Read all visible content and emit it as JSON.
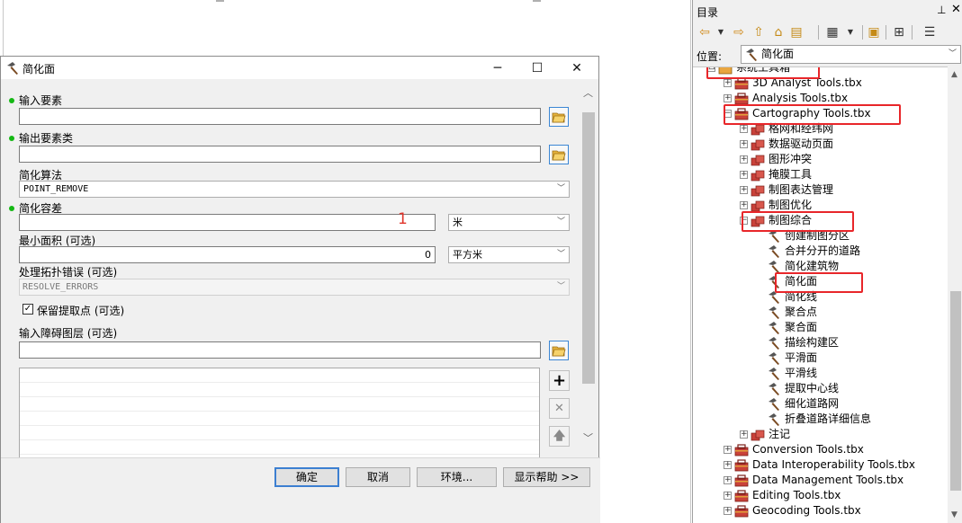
{
  "dialog": {
    "title": "简化面",
    "controls": {
      "minimize": "─",
      "maximize": "☐",
      "close": "✕"
    },
    "fields": {
      "input_features": {
        "label": "输入要素",
        "value": ""
      },
      "output_features": {
        "label": "输出要素类",
        "value": ""
      },
      "algorithm": {
        "label": "简化算法",
        "value": "POINT_REMOVE"
      },
      "tolerance": {
        "label": "简化容差",
        "value": "",
        "unit": "米",
        "annotation": "1"
      },
      "min_area": {
        "label": "最小面积 (可选)",
        "value": "0",
        "unit": "平方米"
      },
      "topology_errors": {
        "label": "处理拓扑错误 (可选)",
        "value": "RESOLVE_ERRORS"
      },
      "keep_points": {
        "label": "保留提取点 (可选)",
        "checked": true,
        "check_mark": "✓"
      },
      "barrier_layers": {
        "label": "输入障碍图层 (可选)",
        "value": ""
      }
    },
    "side_buttons": {
      "add": "+",
      "remove": "✕",
      "up": "🡅"
    },
    "buttons": {
      "ok": "确定",
      "cancel": "取消",
      "env": "环境...",
      "help": "显示帮助 >>"
    }
  },
  "catalog": {
    "title": "目录",
    "pin": "⊥",
    "close": "✕",
    "location_label": "位置:",
    "location_value": "简化面",
    "tree": [
      {
        "label": "系统工具箱",
        "expander": "⊟",
        "type": "toolbox-folder"
      },
      {
        "label": "3D Analyst Tools.tbx",
        "expander": "+",
        "type": "toolbox"
      },
      {
        "label": "Analysis Tools.tbx",
        "expander": "+",
        "type": "toolbox"
      },
      {
        "label": "Cartography Tools.tbx",
        "expander": "−",
        "type": "toolbox"
      },
      {
        "label": "格网和经纬网",
        "expander": "+",
        "type": "toolset"
      },
      {
        "label": "数据驱动页面",
        "expander": "+",
        "type": "toolset"
      },
      {
        "label": "图形冲突",
        "expander": "+",
        "type": "toolset"
      },
      {
        "label": "掩膜工具",
        "expander": "+",
        "type": "toolset"
      },
      {
        "label": "制图表达管理",
        "expander": "+",
        "type": "toolset"
      },
      {
        "label": "制图优化",
        "expander": "+",
        "type": "toolset"
      },
      {
        "label": "制图综合",
        "expander": "−",
        "type": "toolset"
      },
      {
        "label": "创建制图分区",
        "type": "tool"
      },
      {
        "label": "合并分开的道路",
        "type": "tool"
      },
      {
        "label": "简化建筑物",
        "type": "tool"
      },
      {
        "label": "简化面",
        "type": "tool"
      },
      {
        "label": "简化线",
        "type": "tool"
      },
      {
        "label": "聚合点",
        "type": "tool"
      },
      {
        "label": "聚合面",
        "type": "tool"
      },
      {
        "label": "描绘构建区",
        "type": "tool"
      },
      {
        "label": "平滑面",
        "type": "tool"
      },
      {
        "label": "平滑线",
        "type": "tool"
      },
      {
        "label": "提取中心线",
        "type": "tool"
      },
      {
        "label": "细化道路网",
        "type": "tool"
      },
      {
        "label": "折叠道路详细信息",
        "type": "tool"
      },
      {
        "label": "注记",
        "expander": "+",
        "type": "toolset"
      },
      {
        "label": "Conversion Tools.tbx",
        "expander": "+",
        "type": "toolbox"
      },
      {
        "label": "Data Interoperability Tools.tbx",
        "expander": "+",
        "type": "toolbox"
      },
      {
        "label": "Data Management Tools.tbx",
        "expander": "+",
        "type": "toolbox"
      },
      {
        "label": "Editing Tools.tbx",
        "expander": "+",
        "type": "toolbox"
      },
      {
        "label": "Geocoding Tools.tbx",
        "expander": "+",
        "type": "toolbox"
      }
    ]
  },
  "colors": {
    "highlight": "#e8262a",
    "required_dot": "#14b814",
    "primary_border": "#3c7fd1"
  }
}
